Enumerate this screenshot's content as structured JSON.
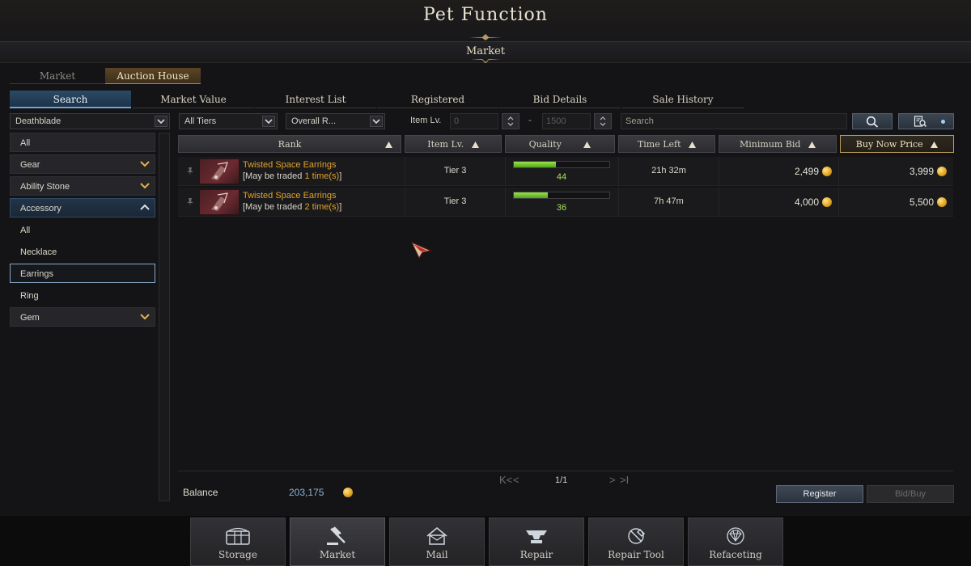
{
  "window": {
    "title": "Pet Function",
    "subtitle": "Market"
  },
  "main_tabs": [
    {
      "label": "Market",
      "active": false
    },
    {
      "label": "Auction House",
      "active": true
    }
  ],
  "sub_tabs": [
    {
      "label": "Search",
      "active": true
    },
    {
      "label": "Market Value",
      "active": false
    },
    {
      "label": "Interest List",
      "active": false
    },
    {
      "label": "Registered",
      "active": false
    },
    {
      "label": "Bid Details",
      "active": false
    },
    {
      "label": "Sale History",
      "active": false
    }
  ],
  "filters": {
    "class": "Deathblade",
    "tier": "All Tiers",
    "sort": "Overall R...",
    "item_lv_label": "Item Lv.",
    "item_lv_min": "0",
    "item_lv_max": "1500",
    "search_placeholder": "Search"
  },
  "categories": [
    {
      "label": "All",
      "style": "header"
    },
    {
      "label": "Gear",
      "style": "header",
      "expandable": true
    },
    {
      "label": "Ability Stone",
      "style": "header",
      "expandable": true
    },
    {
      "label": "Accessory",
      "style": "open",
      "expandable": true
    },
    {
      "label": "All",
      "style": "plain"
    },
    {
      "label": "Necklace",
      "style": "plain"
    },
    {
      "label": "Earrings",
      "style": "selected"
    },
    {
      "label": "Ring",
      "style": "plain"
    },
    {
      "label": "Gem",
      "style": "header",
      "expandable": true
    }
  ],
  "table": {
    "columns": [
      "Rank",
      "Item Lv.",
      "Quality",
      "Time Left",
      "Minimum Bid",
      "Buy Now Price"
    ],
    "sorted_column": "Buy Now Price",
    "rows": [
      {
        "name": "Twisted Space Earrings",
        "trade_prefix": "[May be traded",
        "trade_count": "1 time(s)",
        "trade_suffix": "]",
        "item_lv": "Tier 3",
        "quality": 44,
        "time_left": "21h 32m",
        "min_bid": "2,499",
        "buy_now": "3,999"
      },
      {
        "name": "Twisted Space Earrings",
        "trade_prefix": "[May be traded",
        "trade_count": "2 time(s)",
        "trade_suffix": "]",
        "item_lv": "Tier 3",
        "quality": 36,
        "time_left": "7h 47m",
        "min_bid": "4,000",
        "buy_now": "5,500"
      }
    ]
  },
  "pager": {
    "first": "K<",
    "prev": "<",
    "label": "1/1",
    "next": ">",
    "last": ">I"
  },
  "balance": {
    "label": "Balance",
    "value": "203,175"
  },
  "buttons": {
    "register": "Register",
    "bid_buy": "Bid/Buy"
  },
  "dock": [
    {
      "label": "Storage",
      "icon": "chest-icon",
      "active": false
    },
    {
      "label": "Market",
      "icon": "gavel-icon",
      "active": true
    },
    {
      "label": "Mail",
      "icon": "mailbox-icon",
      "active": false
    },
    {
      "label": "Repair",
      "icon": "anvil-icon",
      "active": false
    },
    {
      "label": "Repair Tool",
      "icon": "repair-tool-icon",
      "active": false
    },
    {
      "label": "Refaceting",
      "icon": "gem-icon",
      "active": false
    }
  ],
  "colors": {
    "accent_gold": "#e0a128",
    "quality_green": "#9ae34a",
    "tab_blue": "#2b4b66",
    "balance_blue": "#8fb2d4"
  }
}
